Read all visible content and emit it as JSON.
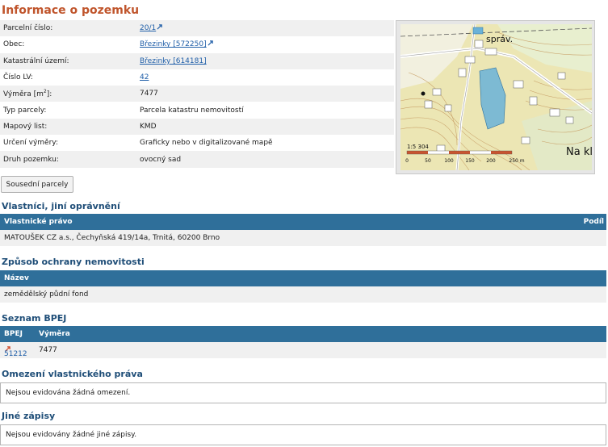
{
  "title": "Informace o pozemku",
  "info": {
    "parcel_number_label": "Parcelní číslo:",
    "parcel_number": "20/1",
    "municipality_label": "Obec:",
    "municipality": "Březinky [572250]",
    "cadastral_label": "Katastrální území:",
    "cadastral": "Březinky [614181]",
    "lv_label": "Číslo LV:",
    "lv": "42",
    "area_label_prefix": "Výměra [m",
    "area_label_sup": "2",
    "area_label_suffix": "]:",
    "area": "7477",
    "parcel_type_label": "Typ parcely:",
    "parcel_type": "Parcela katastru nemovitostí",
    "map_sheet_label": "Mapový list:",
    "map_sheet": "KMD",
    "area_determination_label": "Určení výměry:",
    "area_determination": "Graficky nebo v digitalizované mapě",
    "land_type_label": "Druh pozemku:",
    "land_type": "ovocný sad"
  },
  "map": {
    "label_sprav": "správ.",
    "label_nak": "Na kl",
    "scale_ratio": "1:5 304",
    "scale_ticks": [
      "0",
      "50",
      "100",
      "150",
      "200",
      "250 m"
    ]
  },
  "neighbors_button": "Sousední parcely",
  "owners": {
    "title": "Vlastníci, jiní oprávnění",
    "col_right": "Vlastnické právo",
    "col_share": "Podíl",
    "row": "MATOUŠEK CZ a.s., Čechyňská 419/14a, Trnitá, 60200 Brno"
  },
  "protection": {
    "title": "Způsob ochrany nemovitosti",
    "col_name": "Název",
    "row": "zemědělský půdní fond"
  },
  "bpej": {
    "title": "Seznam BPEJ",
    "col_bpej": "BPEJ",
    "col_area": "Výměra",
    "code": "51212",
    "area": "7477"
  },
  "restrictions": {
    "title": "Omezení vlastnického práva",
    "text": "Nejsou evidována žádná omezení."
  },
  "other": {
    "title": "Jiné zápisy",
    "text": "Nejsou evidovány žádné jiné zápisy."
  },
  "colors": {
    "title": "#c0552c",
    "section_title": "#1f4e78",
    "header_bar": "#2f6f9a",
    "link": "#1f5ea8",
    "map_parcel": "#6ab2d8"
  }
}
